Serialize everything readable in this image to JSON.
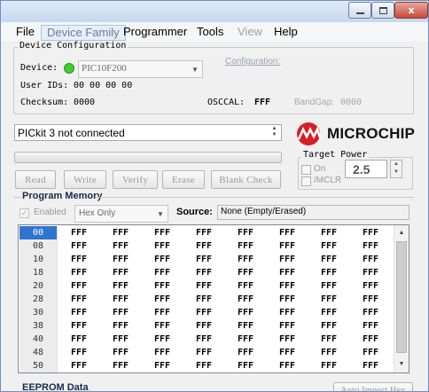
{
  "window": {
    "controls": {
      "minimize_icon": "minimize-icon",
      "maximize_icon": "maximize-icon",
      "close_label": "x"
    }
  },
  "menu": {
    "items": [
      {
        "label": "File"
      },
      {
        "label": "Device Family"
      },
      {
        "label": "Programmer"
      },
      {
        "label": "Tools"
      },
      {
        "label": "View"
      },
      {
        "label": "Help"
      }
    ]
  },
  "device_config": {
    "legend": "Device Configuration",
    "device_label": "Device:",
    "device_value": "PIC10F200",
    "configuration_link": "Configuration:",
    "user_ids_label": "User IDs:",
    "user_ids_value": "00 00 00 00",
    "checksum_label": "Checksum:",
    "checksum_value": "0000",
    "osccal_label": "OSCCAL:",
    "osccal_value": "FFF",
    "bandgap_label": "BandGap:",
    "bandgap_value": "0000",
    "status_color": "#3fcf2f"
  },
  "status": {
    "message": "PICkit 3 not connected"
  },
  "logo": {
    "text": "MICROCHIP",
    "color": "#d42027"
  },
  "target_power": {
    "legend": "Target Power",
    "on_label": "On",
    "mclr_label": "/MCLR",
    "voltage": "2.5"
  },
  "actions": {
    "read": "Read",
    "write": "Write",
    "verify": "Verify",
    "erase": "Erase",
    "blank_check": "Blank Check"
  },
  "program_memory": {
    "title": "Program Memory",
    "enabled_label": "Enabled",
    "enabled_checked": true,
    "mode_value": "Hex Only",
    "source_label": "Source:",
    "source_value": "None (Empty/Erased)",
    "rows": [
      {
        "addr": "00",
        "cells": [
          "FFF",
          "FFF",
          "FFF",
          "FFF",
          "FFF",
          "FFF",
          "FFF",
          "FFF"
        ]
      },
      {
        "addr": "08",
        "cells": [
          "FFF",
          "FFF",
          "FFF",
          "FFF",
          "FFF",
          "FFF",
          "FFF",
          "FFF"
        ]
      },
      {
        "addr": "10",
        "cells": [
          "FFF",
          "FFF",
          "FFF",
          "FFF",
          "FFF",
          "FFF",
          "FFF",
          "FFF"
        ]
      },
      {
        "addr": "18",
        "cells": [
          "FFF",
          "FFF",
          "FFF",
          "FFF",
          "FFF",
          "FFF",
          "FFF",
          "FFF"
        ]
      },
      {
        "addr": "20",
        "cells": [
          "FFF",
          "FFF",
          "FFF",
          "FFF",
          "FFF",
          "FFF",
          "FFF",
          "FFF"
        ]
      },
      {
        "addr": "28",
        "cells": [
          "FFF",
          "FFF",
          "FFF",
          "FFF",
          "FFF",
          "FFF",
          "FFF",
          "FFF"
        ]
      },
      {
        "addr": "30",
        "cells": [
          "FFF",
          "FFF",
          "FFF",
          "FFF",
          "FFF",
          "FFF",
          "FFF",
          "FFF"
        ]
      },
      {
        "addr": "38",
        "cells": [
          "FFF",
          "FFF",
          "FFF",
          "FFF",
          "FFF",
          "FFF",
          "FFF",
          "FFF"
        ]
      },
      {
        "addr": "40",
        "cells": [
          "FFF",
          "FFF",
          "FFF",
          "FFF",
          "FFF",
          "FFF",
          "FFF",
          "FFF"
        ]
      },
      {
        "addr": "48",
        "cells": [
          "FFF",
          "FFF",
          "FFF",
          "FFF",
          "FFF",
          "FFF",
          "FFF",
          "FFF"
        ]
      },
      {
        "addr": "50",
        "cells": [
          "FFF",
          "FFF",
          "FFF",
          "FFF",
          "FFF",
          "FFF",
          "FFF",
          "FFF"
        ]
      }
    ]
  },
  "eeprom": {
    "title": "EEPROM Data",
    "auto_import_label": "Auto Import Hex"
  }
}
